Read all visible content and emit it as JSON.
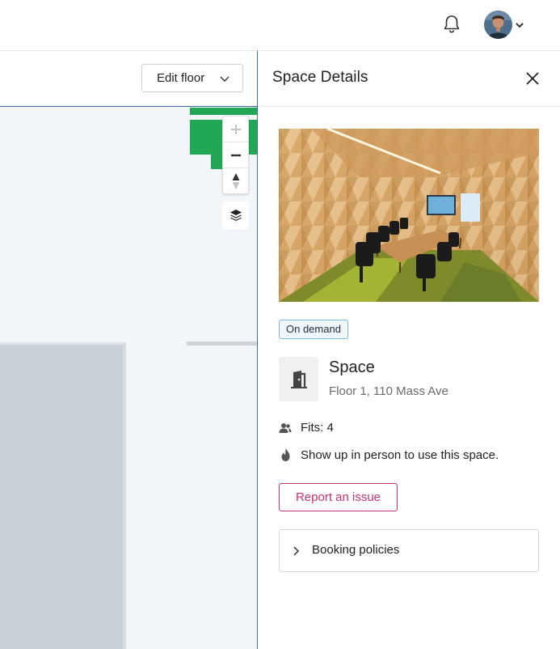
{
  "header": {
    "notifications_icon": "bell-icon",
    "avatar_icon": "user-avatar",
    "menu_icon": "chevron-down-icon"
  },
  "map": {
    "edit_floor_label": "Edit floor",
    "controls": {
      "zoom_in_icon": "plus-icon",
      "zoom_out_icon": "minus-icon",
      "compass_icon": "compass-icon",
      "layers_icon": "layers-icon"
    },
    "colors": {
      "available": "#22a755",
      "room_fill": "#c9d0d6",
      "canvas": "#f3f6f8"
    }
  },
  "panel": {
    "title": "Space Details",
    "close_icon": "close-icon",
    "badge": "On demand",
    "space_type_icon": "door-icon",
    "space_name": "Space",
    "location": "Floor 1, 110 Mass Ave",
    "fits_icon": "people-icon",
    "fits": "Fits: 4",
    "policy_icon": "fire-icon",
    "usage_note": "Show up in person to use this space.",
    "report_label": "Report an issue",
    "booking_policies_label": "Booking policies",
    "accent_color": "#c8327a",
    "badge_border_color": "#7ab8de"
  }
}
